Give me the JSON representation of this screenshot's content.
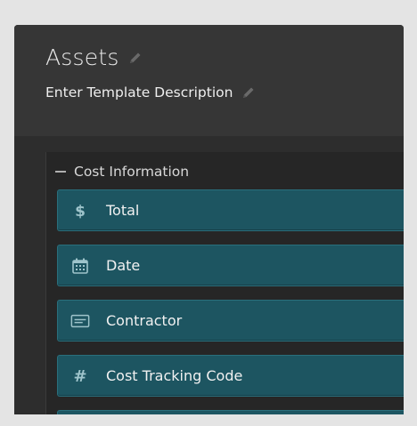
{
  "header": {
    "title": "Assets",
    "description": "Enter Template Description"
  },
  "section": {
    "title": "Cost Information"
  },
  "fields": [
    {
      "label": "Total",
      "icon": "dollar-icon"
    },
    {
      "label": "Date",
      "icon": "calendar-icon"
    },
    {
      "label": "Contractor",
      "icon": "text-field-icon"
    },
    {
      "label": "Cost Tracking Code",
      "icon": "hash-icon"
    }
  ],
  "colors": {
    "field_background": "#1d5561",
    "field_icon": "#9ec4cb",
    "header_background": "#363636",
    "page_background": "#e4e4e4"
  }
}
